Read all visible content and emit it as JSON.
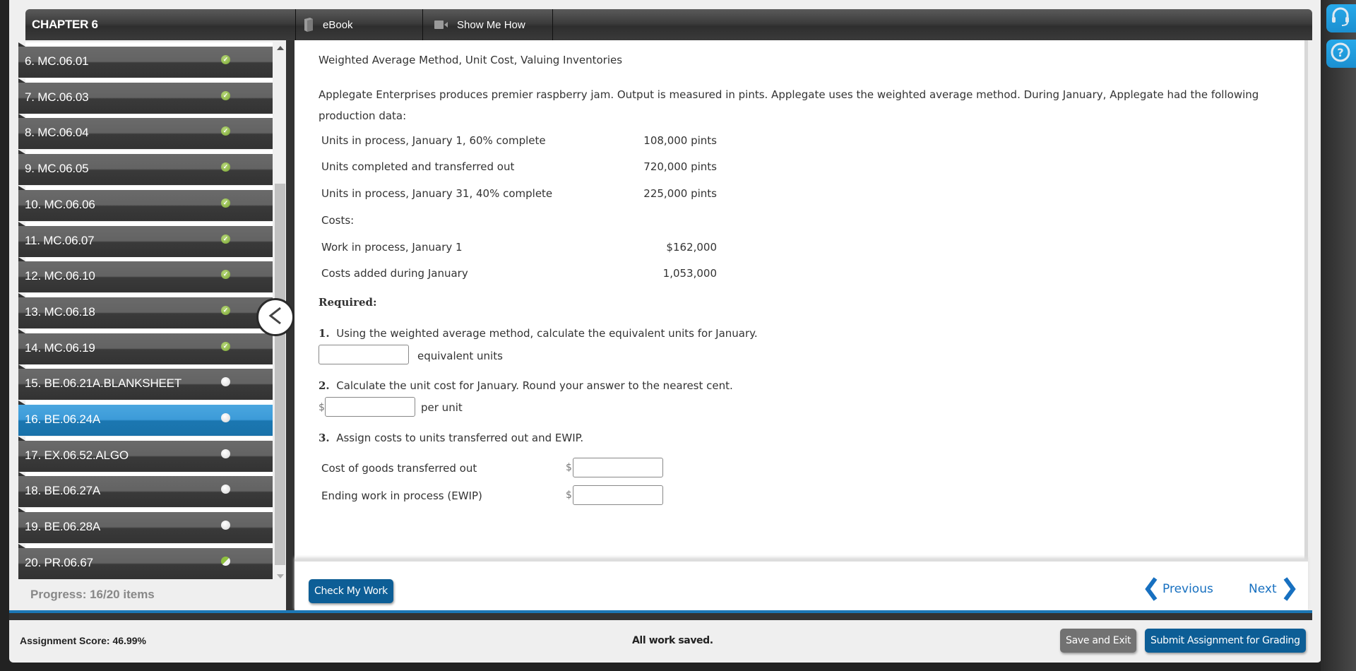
{
  "header": {
    "chapter": "CHAPTER 6",
    "tabs": [
      {
        "label": "eBook",
        "icon": "book-icon"
      },
      {
        "label": "Show Me How",
        "icon": "video-camera-icon"
      }
    ]
  },
  "sidebar": {
    "items": [
      {
        "label": "6. MC.06.01",
        "status": "complete",
        "active": false
      },
      {
        "label": "7. MC.06.03",
        "status": "complete",
        "active": false
      },
      {
        "label": "8. MC.06.04",
        "status": "complete",
        "active": false
      },
      {
        "label": "9. MC.06.05",
        "status": "complete",
        "active": false
      },
      {
        "label": "10. MC.06.06",
        "status": "complete",
        "active": false
      },
      {
        "label": "11. MC.06.07",
        "status": "complete",
        "active": false
      },
      {
        "label": "12. MC.06.10",
        "status": "complete",
        "active": false
      },
      {
        "label": "13. MC.06.18",
        "status": "complete",
        "active": false
      },
      {
        "label": "14. MC.06.19",
        "status": "complete",
        "active": false
      },
      {
        "label": "15. BE.06.21A.BLANKSHEET",
        "status": "empty",
        "active": false
      },
      {
        "label": "16. BE.06.24A",
        "status": "empty",
        "active": true
      },
      {
        "label": "17. EX.06.52.ALGO",
        "status": "empty",
        "active": false
      },
      {
        "label": "18. BE.06.27A",
        "status": "empty",
        "active": false
      },
      {
        "label": "19. BE.06.28A",
        "status": "empty",
        "active": false
      },
      {
        "label": "20. PR.06.67",
        "status": "partial",
        "active": false
      }
    ],
    "progress": "Progress:  16/20 items"
  },
  "question": {
    "title": "Weighted Average Method, Unit Cost, Valuing Inventories",
    "intro": "Applegate Enterprises produces premier raspberry jam. Output is measured in pints. Applegate uses the weighted average method. During January, Applegate had the following production data:",
    "data_rows": [
      {
        "label": "Units in process, January 1, 60% complete",
        "value": "108,000 pints"
      },
      {
        "label": "Units completed and transferred out",
        "value": "720,000 pints"
      },
      {
        "label": "Units in process, January 31, 40% complete",
        "value": "225,000 pints"
      },
      {
        "label": "Costs:",
        "value": ""
      },
      {
        "label": "Work in process, January 1",
        "value": "$162,000"
      },
      {
        "label": "Costs added during January",
        "value": "1,053,000"
      }
    ],
    "required_label": "Required:",
    "steps": [
      {
        "number": "1.",
        "text": "Using the weighted average method, calculate the equivalent units for January.",
        "input_value": "",
        "unit": "equivalent units"
      },
      {
        "number": "2.",
        "text": "Calculate the unit cost for January. Round your answer to the nearest cent.",
        "prefix": "$",
        "input_value": "",
        "unit": "per unit"
      },
      {
        "number": "3.",
        "text": "Assign costs to units transferred out and EWIP."
      }
    ],
    "assign_rows": [
      {
        "label": "Cost of goods transferred out",
        "prefix": "$",
        "input_value": ""
      },
      {
        "label": "Ending work in process (EWIP)",
        "prefix": "$",
        "input_value": ""
      }
    ]
  },
  "footer": {
    "check_label": "Check My Work",
    "previous_label": "Previous",
    "next_label": "Next"
  },
  "statusbar": {
    "score": "Assignment Score:   46.99%",
    "saved": "All work saved.",
    "save_exit_label": "Save and Exit",
    "submit_label": "Submit Assignment for Grading"
  },
  "colors": {
    "accent_blue": "#0d5e96",
    "active_item": "#3c9bd8",
    "complete_green": "#8fc13f",
    "link_blue": "#1770c0"
  }
}
